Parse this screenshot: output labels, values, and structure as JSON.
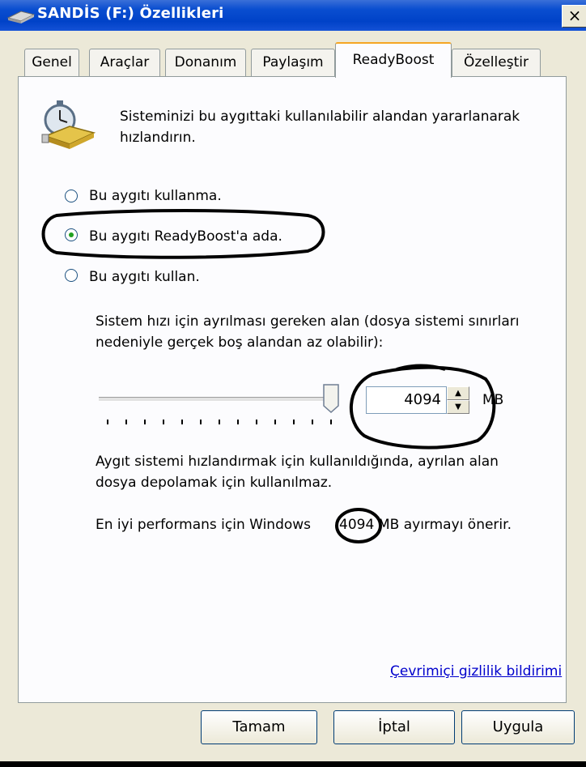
{
  "window": {
    "title": "SANDİS (F:) Özellikleri",
    "close_label": "×"
  },
  "tabs": [
    {
      "label": "Genel"
    },
    {
      "label": "Araçlar"
    },
    {
      "label": "Donanım"
    },
    {
      "label": "Paylaşım"
    },
    {
      "label": "ReadyBoost",
      "active": true
    },
    {
      "label": "Özelleştir"
    }
  ],
  "readyboost": {
    "description_line1": "Sisteminizi bu aygıttaki kullanılabilir alandan yararlanarak",
    "description_line2": "hızlandırın.",
    "options": [
      {
        "label": "Bu aygıtı kullanma.",
        "checked": false
      },
      {
        "label": "Bu aygıtı ReadyBoost'a ada.",
        "checked": true
      },
      {
        "label": "Bu aygıtı kullan.",
        "checked": false
      }
    ],
    "space_line1": "Sistem hızı için ayrılması gereken alan (dosya sistemi sınırları",
    "space_line2": "nedeniyle gerçek boş alandan az olabilir):",
    "slider_fraction": 1.0,
    "spin_value": "4094",
    "unit": "MB",
    "note_line1": "Aygıt sistemi hızlandırmak için kullanıldığında, ayrılan alan",
    "note_line2": "dosya depolamak için kullanılmaz.",
    "recommend_prefix": "En iyi performans için Windows",
    "recommend_value": "4094",
    "recommend_suffix": "MB ayırmayı önerir.",
    "privacy_link": "Çevrimiçi gizlilik bildirimi"
  },
  "buttons": {
    "ok": "Tamam",
    "cancel": "İptal",
    "apply": "Uygula"
  },
  "colors": {
    "titlebar": "#0042c8",
    "accent_tab": "#f5a623",
    "link": "#0000cc"
  }
}
